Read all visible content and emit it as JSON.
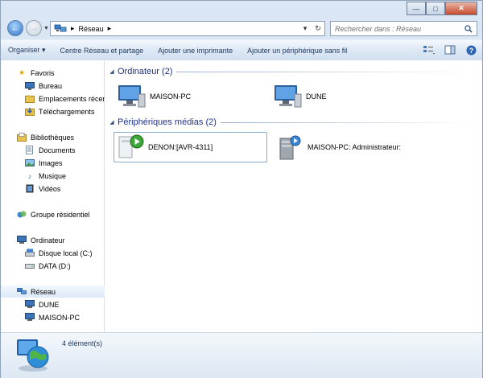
{
  "window": {
    "controls": {
      "minimize": "—",
      "maximize": "□",
      "close": "✕"
    }
  },
  "nav": {
    "back": "←",
    "forward": "→"
  },
  "address": {
    "segments": [
      "Réseau"
    ],
    "refresh": "↻"
  },
  "search": {
    "placeholder": "Rechercher dans : Réseau"
  },
  "toolbar": {
    "items": [
      "Organiser ▾",
      "Centre Réseau et partage",
      "Ajouter une imprimante",
      "Ajouter un périphérique sans fil"
    ]
  },
  "sidebar": {
    "favorites": {
      "label": "Favoris",
      "items": [
        "Bureau",
        "Emplacements récents",
        "Téléchargements"
      ]
    },
    "libraries": {
      "label": "Bibliothèques",
      "items": [
        "Documents",
        "Images",
        "Musique",
        "Vidéos"
      ]
    },
    "homegroup": "Groupe résidentiel",
    "computer": {
      "label": "Ordinateur",
      "items": [
        "Disque local (C:)",
        "DATA (D:)"
      ]
    },
    "network": {
      "label": "Réseau",
      "items": [
        "DUNE",
        "MAISON-PC"
      ]
    }
  },
  "groups": [
    {
      "title": "Ordinateur (2)",
      "items": [
        "MAISON-PC",
        "DUNE"
      ]
    },
    {
      "title": "Périphériques médias (2)",
      "items": [
        "DENON:[AVR-4311]",
        "MAISON-PC: Administrateur:"
      ]
    }
  ],
  "status": {
    "count": "4 élément(s)"
  },
  "colors": {
    "accent": "#1e3287",
    "selection": "#dce9f8"
  }
}
